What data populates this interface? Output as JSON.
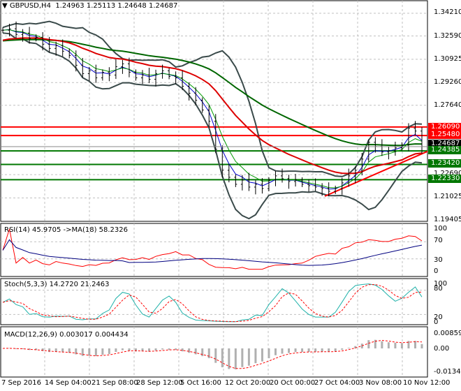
{
  "header": {
    "symbol": "GBPUSD,H4",
    "open": "1.24963",
    "high": "1.25113",
    "low": "1.24648",
    "close": "1.24687"
  },
  "rsi": {
    "label": "RSI(14) 45.9705  ->MA(18) 58.2326",
    "ticks": [
      "100",
      "70",
      "30",
      "0"
    ]
  },
  "stoch": {
    "label": "Stoch(5,3,3) 14.2720 21.2463",
    "ticks": [
      "100",
      "80",
      "20",
      "0"
    ]
  },
  "macd": {
    "label": "MACD(12,26,9) 0.003017 0.004434",
    "ticks": [
      "0.008594",
      "0.00",
      "-0.013407"
    ]
  },
  "colors": {
    "red": "#ff0000",
    "green": "#007700",
    "bid": "#000000"
  },
  "chart_data": {
    "type": "line",
    "title": "GBPUSD,H4",
    "price_ticks": [
      "1.34210",
      "1.32590",
      "1.30925",
      "1.29260",
      "1.27640",
      "1.22690",
      "1.21025",
      "1.19405"
    ],
    "ylim": [
      1.19405,
      1.3421
    ],
    "x_labels": [
      "7 Sep 2016",
      "14 Sep 04:00",
      "21 Sep 08:00",
      "28 Sep 12:00",
      "5 Oct 16:00",
      "12 Oct 20:00",
      "20 Oct 00:00",
      "27 Oct 04:00",
      "3 Nov 08:00",
      "10 Nov 12:00"
    ],
    "current_price": "1.24687",
    "levels": [
      {
        "value": 1.2609,
        "label": "1.26090",
        "color": "red"
      },
      {
        "value": 1.2548,
        "label": "1.25480",
        "color": "red"
      },
      {
        "value": 1.24385,
        "label": "1.24385",
        "color": "green"
      },
      {
        "value": 1.2342,
        "label": "1.23420",
        "color": "green"
      },
      {
        "value": 1.2233,
        "label": "1.22330",
        "color": "green"
      }
    ],
    "closes": [
      1.33,
      1.331,
      1.327,
      1.328,
      1.324,
      1.325,
      1.32,
      1.317,
      1.319,
      1.315,
      1.312,
      1.305,
      1.299,
      1.301,
      1.296,
      1.3,
      1.298,
      1.304,
      1.306,
      1.3,
      1.296,
      1.298,
      1.295,
      1.299,
      1.301,
      1.297,
      1.296,
      1.29,
      1.285,
      1.28,
      1.273,
      1.265,
      1.245,
      1.23,
      1.225,
      1.22,
      1.223,
      1.218,
      1.22,
      1.217,
      1.223,
      1.226,
      1.224,
      1.222,
      1.223,
      1.22,
      1.219,
      1.218,
      1.217,
      1.215,
      1.217,
      1.221,
      1.226,
      1.23,
      1.238,
      1.25,
      1.247,
      1.243,
      1.244,
      1.246,
      1.248,
      1.26,
      1.258,
      1.2469
    ]
  }
}
